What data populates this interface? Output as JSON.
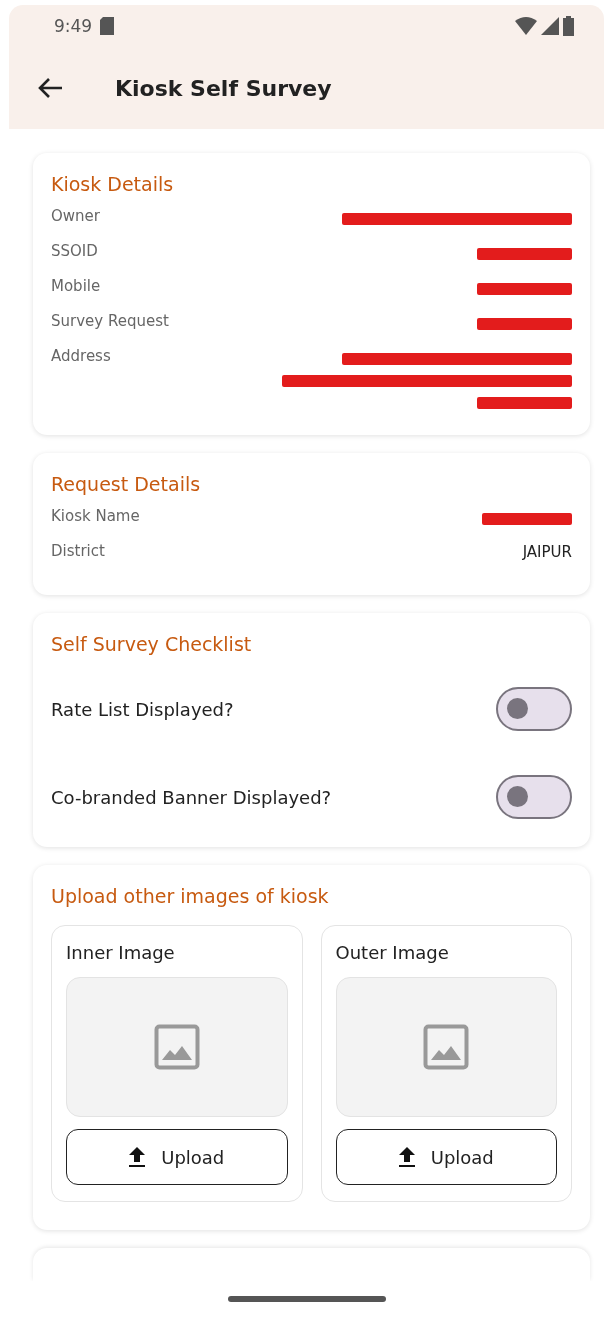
{
  "status_bar": {
    "time": "9:49"
  },
  "app_bar": {
    "title": "Kiosk Self Survey"
  },
  "kiosk_details": {
    "title": "Kiosk Details",
    "rows": [
      {
        "label": "Owner",
        "redacted": [
          {
            "kind": "stroke"
          }
        ]
      },
      {
        "label": "SSOID",
        "redacted": [
          {
            "kind": "short-stroke"
          }
        ]
      },
      {
        "label": "Mobile",
        "redacted": [
          {
            "kind": "short-stroke"
          }
        ]
      },
      {
        "label": "Survey Request",
        "redacted": [
          {
            "kind": "short-stroke"
          }
        ]
      },
      {
        "label": "Address",
        "redacted": [
          {
            "kind": "stroke"
          },
          {
            "kind": "long-stroke"
          },
          {
            "kind": "short-stroke"
          }
        ]
      }
    ]
  },
  "request_details": {
    "title": "Request Details",
    "rows": [
      {
        "label": "Kiosk Name",
        "redacted": [
          {
            "kind": "tiny-stroke"
          }
        ]
      },
      {
        "label": "District",
        "value": "JAIPUR"
      }
    ]
  },
  "checklist": {
    "title": "Self Survey Checklist",
    "items": [
      {
        "label": "Rate List Displayed?",
        "on": false
      },
      {
        "label": "Co-branded Banner Displayed?",
        "on": false
      }
    ]
  },
  "upload": {
    "title": "Upload other images of kiosk",
    "slots": [
      {
        "label": "Inner Image",
        "button": "Upload"
      },
      {
        "label": "Outer Image",
        "button": "Upload"
      }
    ]
  }
}
